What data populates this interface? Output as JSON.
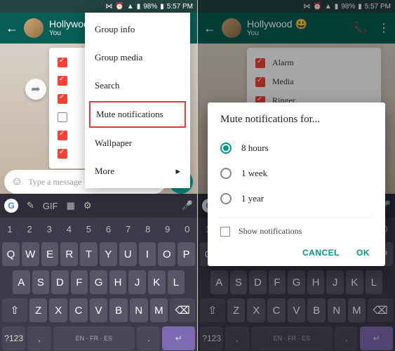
{
  "status": {
    "battery": "98%",
    "time": "5:57 PM"
  },
  "chat": {
    "name": "Hollywood",
    "sub": "You",
    "emoji": "😃"
  },
  "input": {
    "placeholder": "Type a message"
  },
  "menu": {
    "items": [
      "Group info",
      "Group media",
      "Search",
      "Mute notifications",
      "Wallpaper",
      "More"
    ],
    "highlight_index": 3
  },
  "checklist_left": [
    {
      "checked": true,
      "label": ""
    },
    {
      "checked": true,
      "label": ""
    },
    {
      "checked": true,
      "label": ""
    },
    {
      "checked": false,
      "label": ""
    },
    {
      "checked": true,
      "label": ""
    },
    {
      "checked": true,
      "label": ""
    }
  ],
  "checklist_right": [
    {
      "checked": true,
      "label": "Alarm"
    },
    {
      "checked": true,
      "label": "Media"
    },
    {
      "checked": true,
      "label": "Ringer"
    }
  ],
  "dialog": {
    "title": "Mute notifications for...",
    "options": [
      "8 hours",
      "1 week",
      "1 year"
    ],
    "selected": 0,
    "checkbox": "Show notifications",
    "cancel": "CANCEL",
    "ok": "OK"
  },
  "keyboard": {
    "gif": "GIF",
    "nums": [
      "1",
      "2",
      "3",
      "4",
      "5",
      "6",
      "7",
      "8",
      "9",
      "0"
    ],
    "r1": [
      "Q",
      "W",
      "E",
      "R",
      "T",
      "Y",
      "U",
      "I",
      "O",
      "P"
    ],
    "r2": [
      "A",
      "S",
      "D",
      "F",
      "G",
      "H",
      "J",
      "K",
      "L"
    ],
    "r3": [
      "Z",
      "X",
      "C",
      "V",
      "B",
      "N",
      "M"
    ],
    "sym": "?123",
    "lang": "EN · FR · ES"
  }
}
